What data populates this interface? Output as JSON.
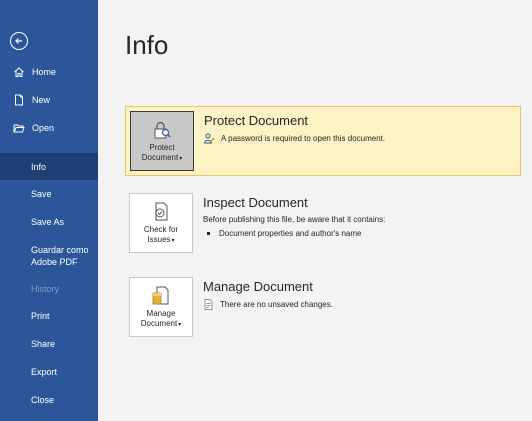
{
  "sidebar": {
    "items": [
      {
        "label": "Home"
      },
      {
        "label": "New"
      },
      {
        "label": "Open"
      },
      {
        "label": "Info"
      },
      {
        "label": "Save"
      },
      {
        "label": "Save As"
      },
      {
        "label": "Guardar como Adobe PDF"
      },
      {
        "label": "History"
      },
      {
        "label": "Print"
      },
      {
        "label": "Share"
      },
      {
        "label": "Export"
      },
      {
        "label": "Close"
      }
    ]
  },
  "page": {
    "title": "Info"
  },
  "protect": {
    "tile_line1": "Protect",
    "tile_line2": "Document",
    "title": "Protect Document",
    "desc": "A password is required to open this document."
  },
  "inspect": {
    "tile_line1": "Check for",
    "tile_line2": "Issues",
    "title": "Inspect Document",
    "desc": "Before publishing this file, be aware that it contains:",
    "bullet": "Document properties and author's name"
  },
  "manage": {
    "tile_line1": "Manage",
    "tile_line2": "Document",
    "title": "Manage Document",
    "desc": "There are no unsaved changes."
  },
  "colors": {
    "sidebar": "#2b579a",
    "sidebar_active": "#1e3f73",
    "highlight": "#fdf2c4",
    "highlight_border": "#e8c66a"
  },
  "icons": {
    "back": "back-arrow-icon",
    "home": "home-icon",
    "new": "new-document-icon",
    "open": "folder-open-icon"
  }
}
